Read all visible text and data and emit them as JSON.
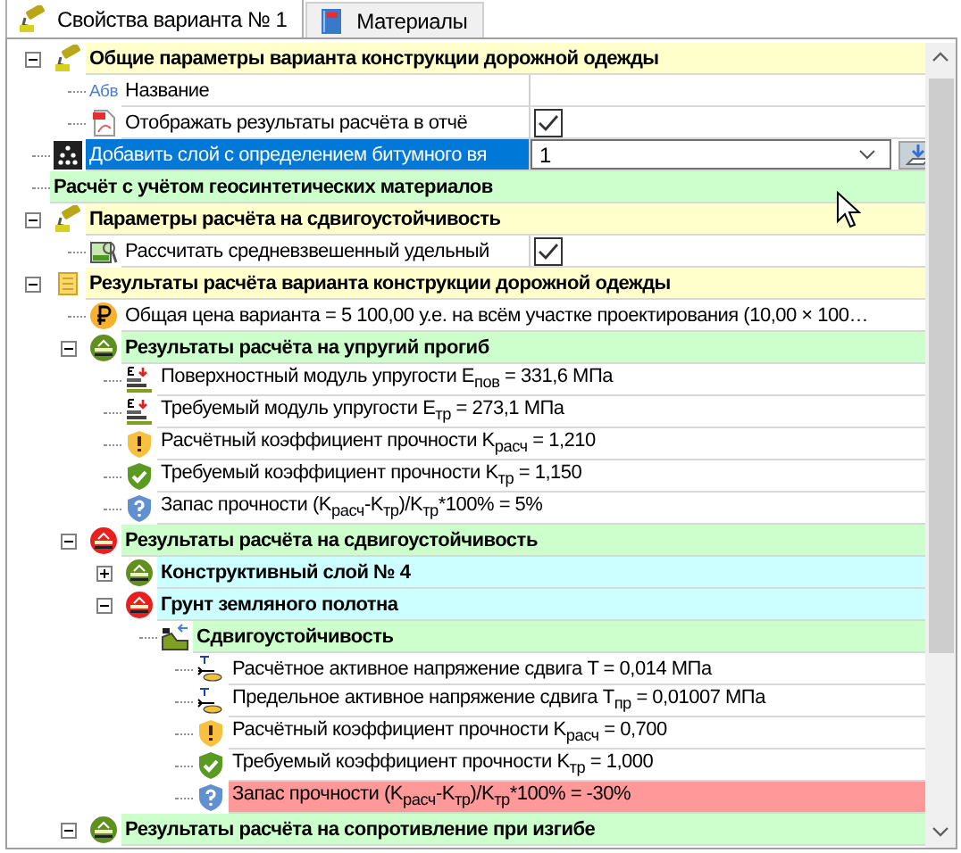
{
  "tabs": [
    {
      "label": "Свойства варианта № 1",
      "kind": "roller",
      "selected": true
    },
    {
      "label": "Материалы",
      "kind": "book",
      "selected": false
    }
  ],
  "tree": {
    "rows": [
      {
        "header": true,
        "label": "Общие параметры варианта конструкции дорожной одежды",
        "kind": "roller",
        "color": "#ffffcc",
        "expanded": true,
        "selected": false,
        "children": [
          {
            "header": false,
            "label": "Название",
            "kind": "abc",
            "icon_text": "Абв",
            "selected": false,
            "editor": {
              "kind": "text"
            }
          },
          {
            "header": false,
            "label": "Отображать результаты расчёта в отчё",
            "kind": "pdf",
            "selected": false,
            "editor": {
              "kind": "checkbox",
              "checked": true
            }
          }
        ]
      },
      {
        "header": false,
        "label": "Добавить слой с определением битумного вя",
        "kind": "dots",
        "selected": true,
        "editor": {
          "kind": "dropdown",
          "value": "1"
        }
      },
      {
        "header": true,
        "label": "Расчёт с учётом геосинтетических материалов",
        "color": "#ccffcc",
        "selected": false
      },
      {
        "header": true,
        "label": "Параметры расчёта на сдвигоустойчивость",
        "kind": "roller",
        "color": "#ffffcc",
        "expanded": true,
        "selected": false,
        "children": [
          {
            "header": false,
            "label": "Рассчитать средневзвешенный удельный",
            "kind": "chart",
            "selected": false,
            "editor": {
              "kind": "checkbox",
              "checked": true
            }
          }
        ]
      },
      {
        "header": true,
        "label": "Результаты расчёта варианта конструкции дорожной одежды",
        "kind": "scroll",
        "color": "#ffffcc",
        "expanded": true,
        "selected": false,
        "children": [
          {
            "header": false,
            "label": "Общая цена варианта = 5 100,00 у.е. на всём участке проектирования (10,00 × 100…",
            "kind": "coin",
            "selected": false
          },
          {
            "header": true,
            "label": "Результаты расчёта на упругий прогиб",
            "kind": "green-badge",
            "color": "#ccffcc",
            "expanded": true,
            "selected": false,
            "children": [
              {
                "header": false,
                "label": "Поверхностный модуль упругости E$_{пов}$ = 331,6 МПа",
                "kind": "modulus",
                "selected": false
              },
              {
                "header": false,
                "label": "Требуемый модуль упругости E$_{тр}$ = 273,1 МПа",
                "kind": "modulus",
                "selected": false
              },
              {
                "header": false,
                "label": "Расчётный коэффициент прочности K$_{расч}$ = 1,210",
                "kind": "warn",
                "selected": false
              },
              {
                "header": false,
                "label": "Требуемый коэффициент прочности K$_{тр}$ = 1,150",
                "kind": "ok",
                "selected": false
              },
              {
                "header": false,
                "label": "Запас прочности (K$_{расч}$-K$_{тр}$)/K$_{тр}$*100% = 5%",
                "kind": "help",
                "selected": false
              }
            ]
          },
          {
            "header": true,
            "label": "Результаты расчёта на сдвигоустойчивость",
            "kind": "red-badge",
            "color": "#ccffcc",
            "expanded": true,
            "selected": false,
            "children": [
              {
                "header": true,
                "label": "Конструктивный слой № 4",
                "kind": "green-badge",
                "color": "#ccffff",
                "expanded": false,
                "selected": false
              },
              {
                "header": true,
                "label": "Грунт земляного полотна",
                "kind": "red-badge",
                "color": "#ccffff",
                "expanded": true,
                "selected": false,
                "children": [
                  {
                    "header": true,
                    "label": "Сдвигоустойчивость",
                    "kind": "slope",
                    "color": "#ccffcc",
                    "selected": false,
                    "children": [
                      {
                        "header": false,
                        "label": "Расчётное активное напряжение сдвига T = 0,014 МПа",
                        "kind": "shear",
                        "selected": false
                      },
                      {
                        "header": false,
                        "label": "Предельное активное напряжение сдвига T$_{пр}$ = 0,01007 МПа",
                        "kind": "shear",
                        "selected": false
                      },
                      {
                        "header": false,
                        "label": "Расчётный коэффициент прочности K$_{расч}$ = 0,700",
                        "kind": "warn",
                        "selected": false
                      },
                      {
                        "header": false,
                        "label": "Требуемый коэффициент прочности K$_{тр}$ = 1,000",
                        "kind": "ok",
                        "selected": false
                      },
                      {
                        "header": false,
                        "label": "Запас прочности (K$_{расч}$-K$_{тр}$)/K$_{тр}$*100% = -30%",
                        "kind": "help",
                        "color": "#ff9999",
                        "selected": false
                      }
                    ]
                  }
                ]
              }
            ]
          },
          {
            "header": true,
            "label": "Результаты расчёта на сопротивление при изгибе",
            "kind": "green-badge",
            "color": "#ccffcc",
            "expanded": true,
            "selected": false
          }
        ]
      }
    ]
  }
}
